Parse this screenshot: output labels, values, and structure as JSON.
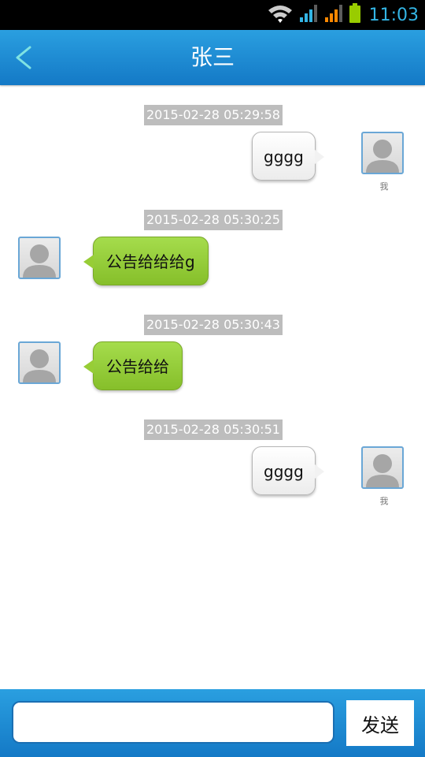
{
  "status_bar": {
    "time": "11:03",
    "icons": [
      "wifi-icon",
      "signal-icon",
      "signal-icon",
      "battery-icon"
    ],
    "colors": {
      "wifi": "#cccccc",
      "signal1": "#33b5e5",
      "signal2": "#ff8800",
      "battery": "#99cc00"
    }
  },
  "header": {
    "title": "张三",
    "back_icon": "chevron-left-icon",
    "accent": "#1e8fd6"
  },
  "messages": [
    {
      "timestamp": "2015-02-28 05:29:58",
      "side": "right",
      "text": "gggg",
      "sender_label": "我"
    },
    {
      "timestamp": "2015-02-28 05:30:25",
      "side": "left",
      "text": "公告给给给g"
    },
    {
      "timestamp": "2015-02-28 05:30:43",
      "side": "left",
      "text": "公告给给"
    },
    {
      "timestamp": "2015-02-28 05:30:51",
      "side": "right",
      "text": "gggg",
      "sender_label": "我"
    }
  ],
  "composer": {
    "value": "",
    "placeholder": "",
    "send_label": "发送"
  }
}
